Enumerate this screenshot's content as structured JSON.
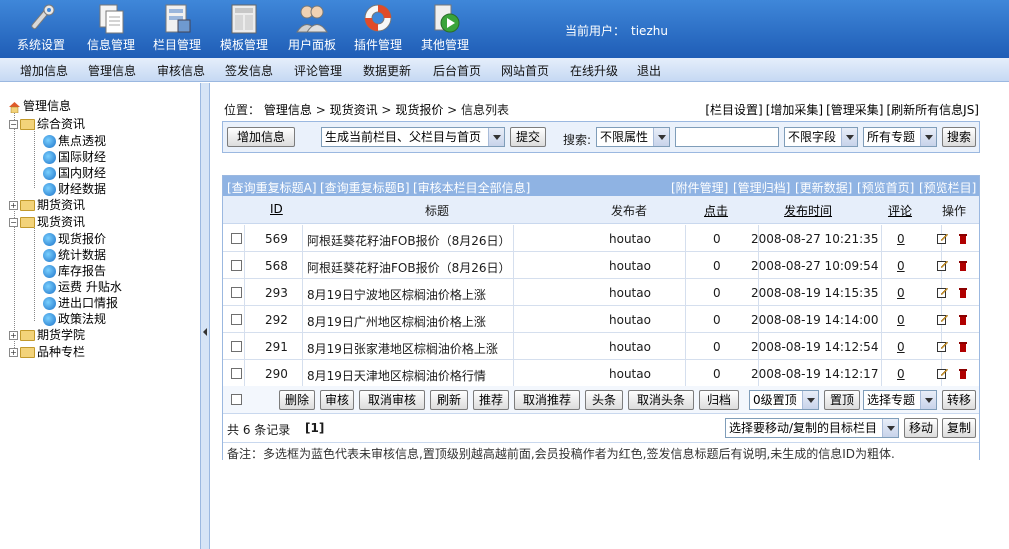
{
  "header": {
    "menu": [
      {
        "label": "系统设置",
        "icon": "tools-icon"
      },
      {
        "label": "信息管理",
        "icon": "documents-icon"
      },
      {
        "label": "栏目管理",
        "icon": "column-icon"
      },
      {
        "label": "模板管理",
        "icon": "template-icon"
      },
      {
        "label": "用户面板",
        "icon": "users-icon"
      },
      {
        "label": "插件管理",
        "icon": "lifebuoy-icon"
      },
      {
        "label": "其他管理",
        "icon": "media-icon"
      }
    ],
    "current_user_label": "当前用户：",
    "current_user": "tiezhu"
  },
  "subnav": [
    "增加信息",
    "管理信息",
    "审核信息",
    "签发信息",
    "评论管理",
    "数据更新",
    "后台首页",
    "网站首页",
    "在线升级",
    "退出"
  ],
  "tree": {
    "root": "管理信息",
    "groups": [
      {
        "label": "综合资讯",
        "children": [
          "焦点透视",
          "国际财经",
          "国内财经",
          "财经数据"
        ]
      },
      {
        "label": "期货资讯",
        "children": []
      },
      {
        "label": "现货资讯",
        "children": [
          "现货报价",
          "统计数据",
          "库存报告",
          "运费 升贴水",
          "进出口情报",
          "政策法规"
        ]
      },
      {
        "label": "期货学院",
        "children": []
      },
      {
        "label": "品种专栏",
        "children": []
      }
    ]
  },
  "location": {
    "prefix": "位置：",
    "crumbs": [
      "管理信息",
      "现货资讯",
      "现货报价"
    ],
    "sep": ">",
    "current": "信息列表"
  },
  "top_links": [
    "[栏目设置]",
    "[增加采集]",
    "[管理采集]",
    "[刷新所有信息JS]"
  ],
  "actionbar": {
    "add_button": "增加信息",
    "generate_select": "生成当前栏目、父栏目与首页",
    "submit_button": "提交",
    "search_label": "搜索:",
    "attr_select": "不限属性",
    "search_value": "",
    "field_select": "不限字段",
    "topic_select": "所有专题",
    "search_button": "搜索"
  },
  "list_links_left": [
    "[查询重复标题A]",
    "[查询重复标题B]",
    "[审核本栏目全部信息]"
  ],
  "list_links_right": [
    "[附件管理]",
    "[管理归档]",
    "[更新数据]",
    "[预览首页]",
    "[预览栏目]"
  ],
  "columns": {
    "id": "ID",
    "title": "标题",
    "publisher": "发布者",
    "clicks": "点击",
    "time": "发布时间",
    "comments": "评论",
    "ops": "操作"
  },
  "rows": [
    {
      "id": "569",
      "title": "阿根廷葵花籽油FOB报价（8月26日）",
      "publisher": "houtao",
      "clicks": "0",
      "time": "2008-08-27 10:21:35",
      "comments": "0"
    },
    {
      "id": "568",
      "title": "阿根廷葵花籽油FOB报价（8月26日）",
      "publisher": "houtao",
      "clicks": "0",
      "time": "2008-08-27 10:09:54",
      "comments": "0"
    },
    {
      "id": "293",
      "title": "8月19日宁波地区棕榈油价格上涨",
      "publisher": "houtao",
      "clicks": "0",
      "time": "2008-08-19 14:15:35",
      "comments": "0"
    },
    {
      "id": "292",
      "title": "8月19日广州地区棕榈油价格上涨",
      "publisher": "houtao",
      "clicks": "0",
      "time": "2008-08-19 14:14:00",
      "comments": "0"
    },
    {
      "id": "291",
      "title": "8月19日张家港地区棕榈油价格上涨",
      "publisher": "houtao",
      "clicks": "0",
      "time": "2008-08-19 14:12:54",
      "comments": "0"
    },
    {
      "id": "290",
      "title": "8月19日天津地区棕榈油价格行情",
      "publisher": "houtao",
      "clicks": "0",
      "time": "2008-08-19 14:12:17",
      "comments": "0"
    }
  ],
  "batch": {
    "buttons": [
      "删除",
      "审核",
      "取消审核",
      "刷新",
      "推荐",
      "取消推荐",
      "头条",
      "取消头条",
      "归档"
    ],
    "top_level_select": "0级置顶",
    "top_button": "置顶",
    "topic_select": "选择专题",
    "move_button": "转移"
  },
  "footer": {
    "count_text": "共 6 条记录",
    "page": "[1]",
    "target_select": "选择要移动/复制的目标栏目",
    "move_button": "移动",
    "copy_button": "复制"
  },
  "note": "备注：多选框为蓝色代表未审核信息,置顶级别越高越前面,会员投稿作者为红色,签发信息标题后有说明,未生成的信息ID为粗体."
}
